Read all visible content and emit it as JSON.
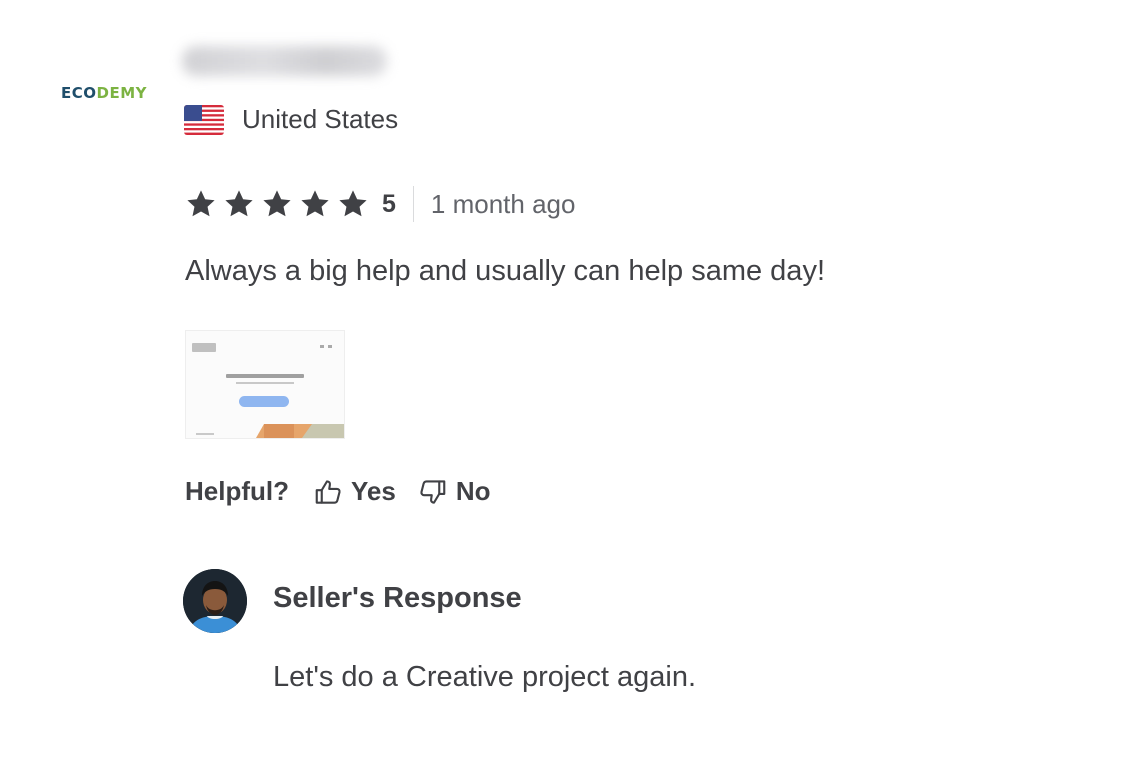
{
  "brand": {
    "logo_part1": "ECO",
    "logo_part2": "DEMY"
  },
  "review": {
    "country": "United States",
    "flag_icon": "us-flag-icon",
    "rating": {
      "value": "5",
      "stars": 5,
      "max": 5
    },
    "time_ago": "1 month ago",
    "text": "Always a big help and usually can help same day!"
  },
  "feedback": {
    "label": "Helpful?",
    "yes": "Yes",
    "no": "No"
  },
  "seller_response": {
    "title": "Seller's Response",
    "text": "Let's do a Creative project again."
  },
  "colors": {
    "text": "#404145",
    "muted": "#62646a",
    "star": "#404145",
    "brand_dark": "#1f4e6b",
    "brand_green": "#7cb342"
  }
}
